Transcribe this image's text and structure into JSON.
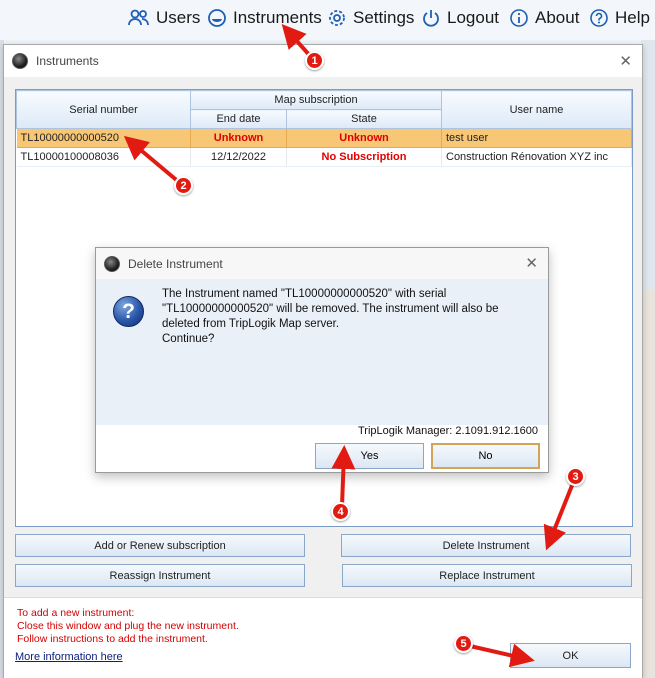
{
  "nav": {
    "users": "Users",
    "instruments": "Instruments",
    "settings": "Settings",
    "logout": "Logout",
    "about": "About",
    "help": "Help"
  },
  "instruments_dialog": {
    "title": "Instruments",
    "columns": {
      "serial": "Serial number",
      "map_subscription": "Map subscription",
      "end_date": "End date",
      "state": "State",
      "user_name": "User name"
    },
    "rows": [
      {
        "serial": "TL10000000000520",
        "end_date": "Unknown",
        "state": "Unknown",
        "user": "test user"
      },
      {
        "serial": "TL10000100008036",
        "end_date": "12/12/2022",
        "state": "No Subscription",
        "user": "Construction Rénovation XYZ inc"
      }
    ],
    "buttons": {
      "add_renew": "Add or Renew subscription",
      "delete": "Delete Instrument",
      "reassign": "Reassign Instrument",
      "replace": "Replace Instrument",
      "ok": "OK"
    },
    "note": [
      "To add a new instrument:",
      "Close this window and plug the new instrument.",
      "Follow instructions to add the instrument."
    ],
    "more_info": "More  information here"
  },
  "confirm_dialog": {
    "title": "Delete Instrument",
    "message_lines": [
      "The Instrument named \"TL10000000000520\" with serial",
      "\"TL10000000000520\" will be removed. The instrument will also be",
      "deleted from TripLogik Map server.",
      "Continue?"
    ],
    "version": "TripLogik Manager: 2.1091.912.1600",
    "yes": "Yes",
    "no": "No"
  },
  "callouts": [
    "1",
    "2",
    "3",
    "4",
    "5"
  ],
  "colors": {
    "callout": "#e21b12",
    "selected_row": "#f8c776",
    "warning_text": "#e00000"
  }
}
